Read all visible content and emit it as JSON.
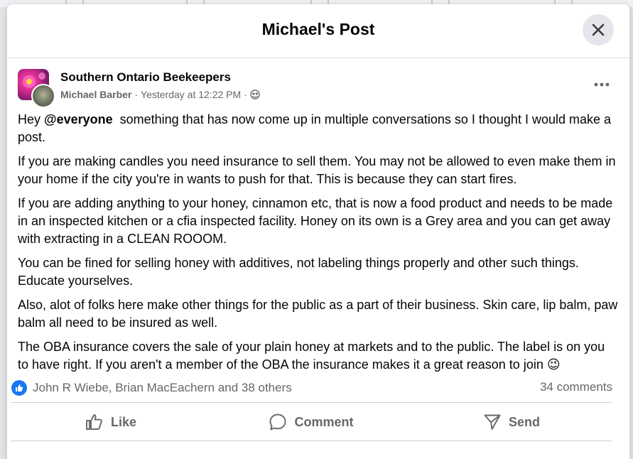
{
  "modal": {
    "title": "Michael's Post",
    "close_icon": "close-icon"
  },
  "post": {
    "group_name": "Southern Ontario Beekeepers",
    "author": "Michael Barber",
    "timestamp": "Yesterday at 12:22 PM",
    "visibility_icon": "globe-icon",
    "more_icon": "more-horizontal-icon",
    "paragraphs": [
      {
        "prefix": "Hey ",
        "mention": "@everyone",
        "text": "  something that has now come up in multiple conversations so I thought I would make a post."
      },
      {
        "text": "If you are making candles you need insurance to sell them. You may not be allowed to even make them in your home if the city you're in wants to push for that. This is because they can start fires."
      },
      {
        "text": "If you are adding anything to your honey, cinnamon etc, that is now a food product and needs to be made in an inspected kitchen or a cfia inspected facility. Honey on its own is a Grey area and you can get away with extracting in a CLEAN ROOOM."
      },
      {
        "text": "You can be fined for selling honey with additives, not labeling things properly and other such things. Educate yourselves."
      },
      {
        "text": "Also, alot of folks here make other things for the public as a part of their business. Skin care, lip balm, paw balm all need to be insured as well."
      },
      {
        "text": "The OBA insurance covers the sale of your plain honey at markets and to the public. The label is on you to have right. If you aren't a member of the OBA the insurance makes it a great reason to join",
        "emoji": "😉"
      }
    ]
  },
  "reactions": {
    "names": "John R Wiebe, Brian MacEachern and 38 others",
    "comments": "34 comments",
    "like_color": "#1877f2"
  },
  "actions": [
    {
      "label": "Like",
      "icon": "thumbs-up-icon"
    },
    {
      "label": "Comment",
      "icon": "comment-icon"
    },
    {
      "label": "Send",
      "icon": "send-icon"
    }
  ]
}
